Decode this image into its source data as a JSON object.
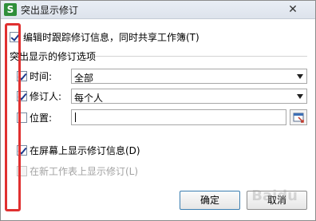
{
  "window": {
    "app_icon": "S",
    "title": "突出显示修订",
    "close_glyph": "✕"
  },
  "options": {
    "track_changes": {
      "label": "编辑时跟踪修订信息，同时共享工作簿(T)",
      "checked": true
    },
    "section_title": "突出显示的修订选项",
    "time": {
      "label": "时间:",
      "checked": true,
      "value": "全部"
    },
    "reviser": {
      "label": "修订人:",
      "checked": true,
      "value": "每个人"
    },
    "location": {
      "label": "位置:",
      "checked": false,
      "value": ""
    },
    "show_on_screen": {
      "label": "在屏幕上显示修订信息(D)",
      "checked": true
    },
    "list_in_new_sheet": {
      "label": "在新工作表上显示修订(L)",
      "checked": false,
      "disabled": true
    }
  },
  "buttons": {
    "ok": "确定",
    "cancel": "取消"
  },
  "watermark_text": "Baidu",
  "colors": {
    "highlight": "#e03030",
    "app_icon": "#2f8f3a",
    "check": "#1e3b8c"
  }
}
